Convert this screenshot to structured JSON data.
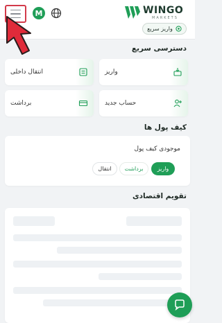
{
  "header": {
    "avatar_letter": "M",
    "logo_name": "WINGO",
    "logo_sub": "MARKETS",
    "quick_deposit_label": "واریز سریع"
  },
  "quick_access": {
    "title": "دسترسی سریع",
    "items": [
      {
        "label": "واریز",
        "icon": "deposit-icon"
      },
      {
        "label": "انتقال داخلی",
        "icon": "transfer-icon"
      },
      {
        "label": "حساب جدید",
        "icon": "add-user-icon"
      },
      {
        "label": "برداشت",
        "icon": "withdraw-icon"
      }
    ]
  },
  "wallet": {
    "title": "کیف پول ها",
    "balance_label": "موجودی کیف پول",
    "buttons": {
      "deposit": "واریز",
      "withdraw": "برداشت",
      "transfer": "انتقال"
    }
  },
  "calendar": {
    "title": "تقویم اقتصادی"
  },
  "colors": {
    "accent": "#1f9e57",
    "highlight_border": "#d33a4a",
    "background": "#f1f3f5"
  }
}
